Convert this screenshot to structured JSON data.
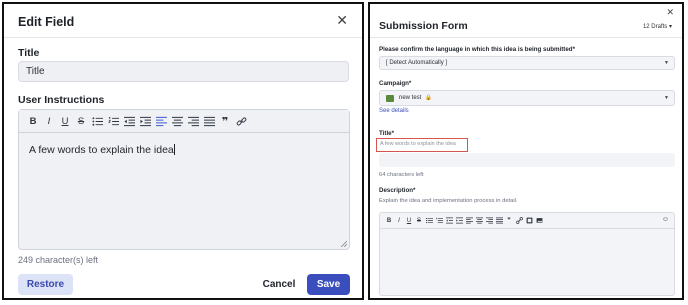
{
  "edit_field": {
    "title": "Edit Field",
    "close_glyph": "✕",
    "title_label": "Title",
    "title_value": "Title",
    "instructions_label": "User Instructions",
    "editor_text": "A few words to explain the idea",
    "chars_left": "249 character(s) left",
    "restore_label": "Restore",
    "cancel_label": "Cancel",
    "save_label": "Save",
    "accent_color": "#3a4fbd"
  },
  "toolbar_glyphs": {
    "bold": "B",
    "italic": "I",
    "underline": "U",
    "strike": "S",
    "quote": "❞"
  },
  "submission_form": {
    "close_glyph": "✕",
    "title": "Submission Form",
    "drafts": "12 Drafts ▾",
    "language_label": "Please confirm the language in which this idea is being submitted",
    "language_required": "*",
    "language_value": "[ Detect Automatically ]",
    "campaign_label": "Campaign",
    "campaign_required": "*",
    "campaign_value": "new test",
    "see_details": "See details",
    "title_label": "Title",
    "title_required": "*",
    "title_placeholder": "A few words to explain the idea",
    "title_chars_left": "64 characters left",
    "description_label": "Description",
    "description_required": "*",
    "description_hint": "Explain the idea and implementation process in detail.",
    "highlight_color": "#d9534f"
  }
}
